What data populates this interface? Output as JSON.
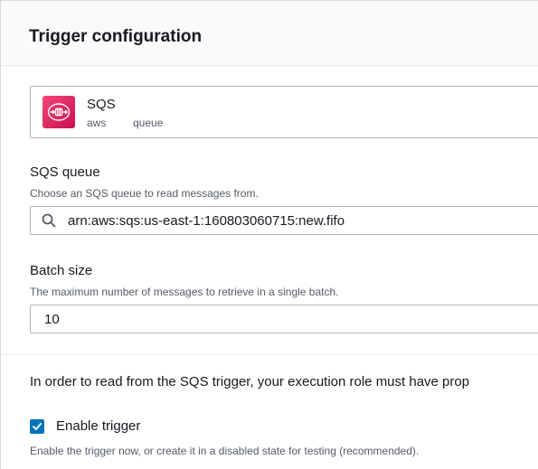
{
  "panel": {
    "title": "Trigger configuration"
  },
  "service": {
    "name": "SQS",
    "tags": [
      "aws",
      "queue"
    ],
    "icon": "sqs-service-icon",
    "icon_color": "#e7157b"
  },
  "sqs_queue": {
    "label": "SQS queue",
    "description": "Choose an SQS queue to read messages from.",
    "value": "arn:aws:sqs:us-east-1:160803060715:new.fifo",
    "icon": "search-icon"
  },
  "batch_size": {
    "label": "Batch size",
    "description": "The maximum number of messages to retrieve in a single batch.",
    "value": "10"
  },
  "info": {
    "text": "In order to read from the SQS trigger, your execution role must have prop"
  },
  "enable_trigger": {
    "checked": true,
    "label": "Enable trigger",
    "description": "Enable the trigger now, or create it in a disabled state for testing (recommended).",
    "accent": "#0073bb"
  }
}
